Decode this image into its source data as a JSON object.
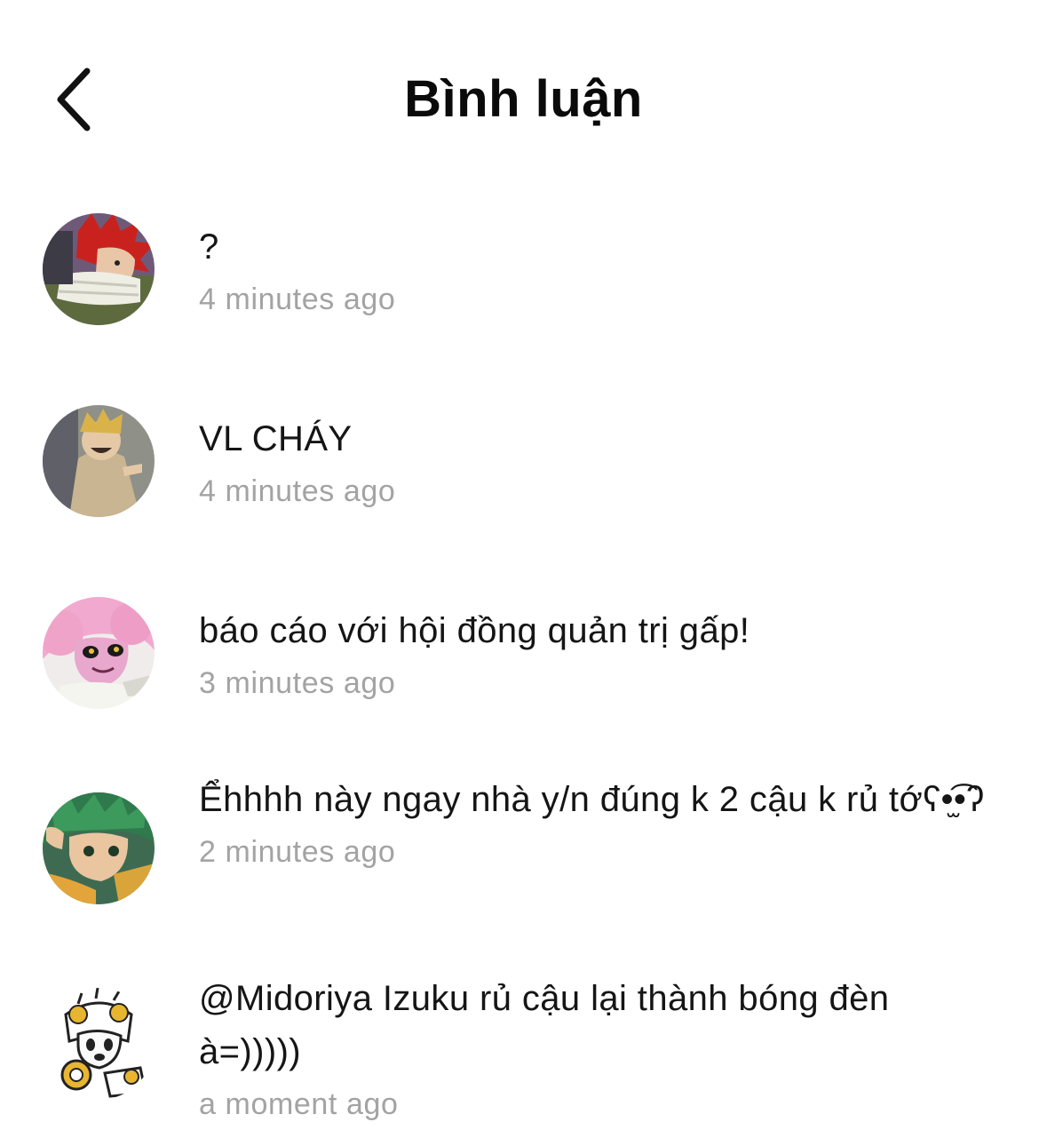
{
  "header": {
    "title": "Bình luận",
    "back_icon": "chevron-left-icon"
  },
  "comments": [
    {
      "text": "?",
      "time": "4 minutes ago",
      "avatar": "avatar-red-hair"
    },
    {
      "text": "VL CHÁY",
      "time": "4 minutes ago",
      "avatar": "avatar-blonde"
    },
    {
      "text": "báo cáo với hội đồng quản trị gấp!",
      "time": "3 minutes ago",
      "avatar": "avatar-pink-hair"
    },
    {
      "text": "Ểhhhh này ngay nhà y/n đúng k 2 cậu k rủ tớʕ•̫͡•ʔ",
      "time": "2 minutes ago",
      "avatar": "avatar-green-hair"
    },
    {
      "text": "@Midoriya Izuku rủ cậu lại thành bóng đèn à=)))))",
      "time": "a moment ago",
      "avatar": "avatar-sketch"
    }
  ]
}
